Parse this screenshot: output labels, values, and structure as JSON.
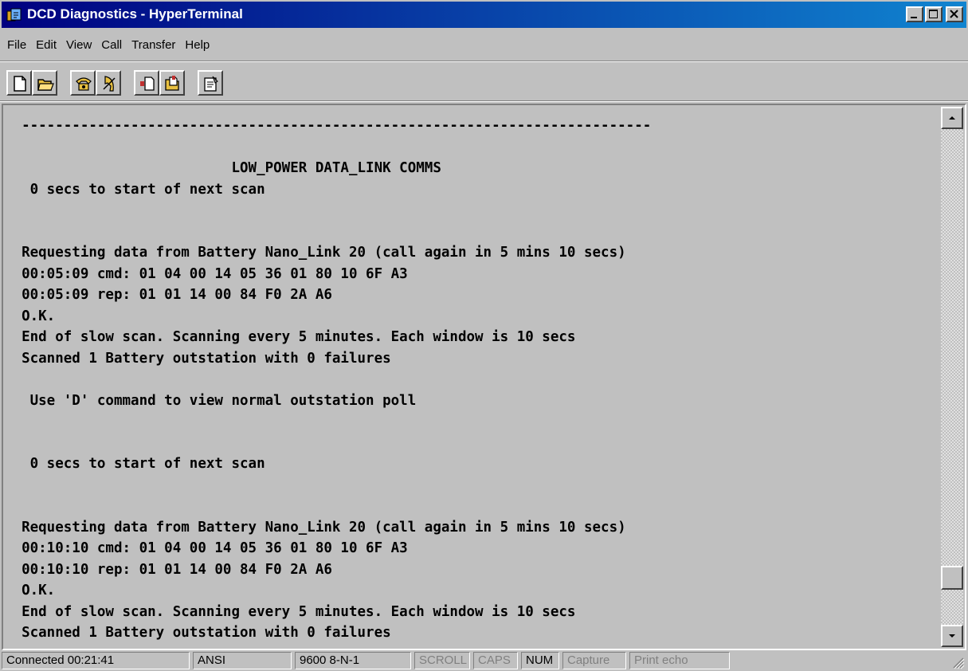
{
  "window": {
    "title": "DCD Diagnostics - HyperTerminal",
    "app_icon": "hyperterminal-icon",
    "controls": [
      "minimize-icon",
      "maximize-icon",
      "close-icon"
    ]
  },
  "menu": [
    {
      "label": "File"
    },
    {
      "label": "Edit"
    },
    {
      "label": "View"
    },
    {
      "label": "Call"
    },
    {
      "label": "Transfer"
    },
    {
      "label": "Help"
    }
  ],
  "toolbar": {
    "groups": [
      [
        "new-document-icon",
        "open-folder-icon"
      ],
      [
        "call-phone-icon",
        "disconnect-phone-icon"
      ],
      [
        "send-file-icon",
        "receive-file-icon"
      ],
      [
        "properties-icon"
      ]
    ]
  },
  "terminal": {
    "lines": [
      "  ---------------------------------------------------------------------------",
      "",
      "                           LOW_POWER DATA_LINK COMMS",
      "   0 secs to start of next scan",
      "",
      "",
      "  Requesting data from Battery Nano_Link 20 (call again in 5 mins 10 secs)",
      "  00:05:09 cmd: 01 04 00 14 05 36 01 80 10 6F A3",
      "  00:05:09 rep: 01 01 14 00 84 F0 2A A6",
      "  O.K.",
      "  End of slow scan. Scanning every 5 minutes. Each window is 10 secs",
      "  Scanned 1 Battery outstation with 0 failures",
      "",
      "   Use 'D' command to view normal outstation poll",
      "",
      "",
      "   0 secs to start of next scan",
      "",
      "",
      "  Requesting data from Battery Nano_Link 20 (call again in 5 mins 10 secs)",
      "  00:10:10 cmd: 01 04 00 14 05 36 01 80 10 6F A3",
      "  00:10:10 rep: 01 01 14 00 84 F0 2A A6",
      "  O.K.",
      "  End of slow scan. Scanning every 5 minutes. Each window is 10 secs",
      "  Scanned 1 Battery outstation with 0 failures"
    ]
  },
  "status": {
    "connected": "Connected 00:21:41",
    "emulation": "ANSI",
    "port_settings": "9600 8-N-1",
    "scroll": "SCROLL",
    "caps": "CAPS",
    "num": "NUM",
    "capture": "Capture",
    "print_echo": "Print echo"
  }
}
